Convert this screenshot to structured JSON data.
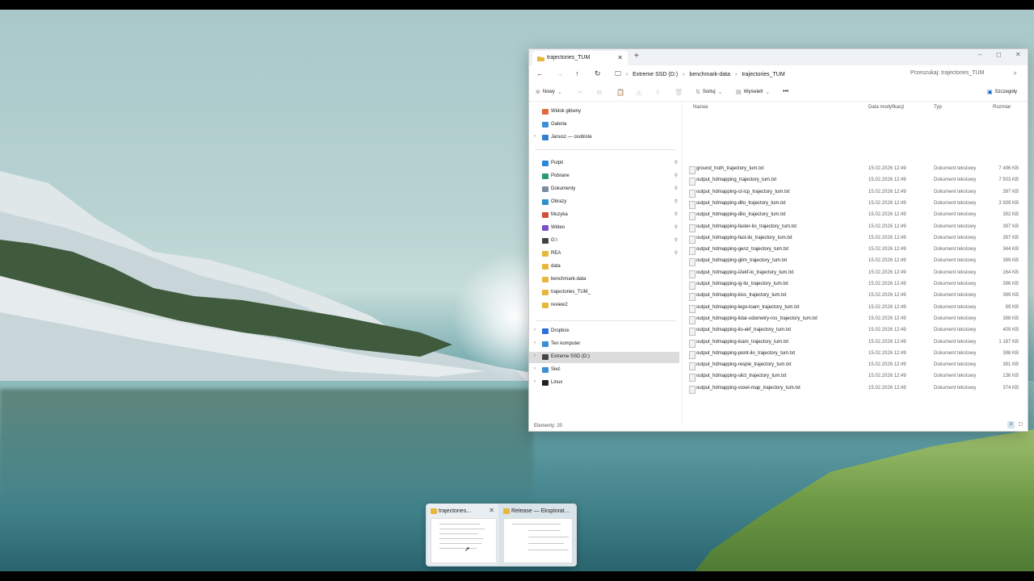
{
  "window": {
    "tab_title": "trajectories_TUM",
    "new_tab": "+",
    "controls": [
      "–",
      "◻",
      "✕"
    ]
  },
  "nav": {
    "breadcrumbs": [
      "Extreme SSD (D:)",
      "benchmark-data",
      "trajectories_TUM"
    ],
    "search_placeholder": "Przeszukaj: trajectories_TUM"
  },
  "toolbar": {
    "new_label": "Nowy",
    "sort_label": "Sortuj",
    "view_label": "Wyświetl",
    "more_label": "•••",
    "details_label": "Szczegóły"
  },
  "sidebar": {
    "items": [
      {
        "label": "Widok główny",
        "color": "#e06a3a",
        "chevron": false,
        "pin": false
      },
      {
        "label": "Galeria",
        "color": "#3a8fd6",
        "chevron": false,
        "pin": false
      },
      {
        "label": "Janusz — osobiste",
        "color": "#2f7fd0",
        "chevron": true,
        "pin": false
      },
      {
        "label": "Pulpit",
        "color": "#2b86d8",
        "chevron": false,
        "pin": true
      },
      {
        "label": "Pobrane",
        "color": "#2a9a6a",
        "chevron": false,
        "pin": true
      },
      {
        "label": "Dokumenty",
        "color": "#7d8d9e",
        "chevron": false,
        "pin": true
      },
      {
        "label": "Obrazy",
        "color": "#2f8fd0",
        "chevron": false,
        "pin": true
      },
      {
        "label": "Muzyka",
        "color": "#d0503a",
        "chevron": false,
        "pin": true
      },
      {
        "label": "Wideo",
        "color": "#7b4fc8",
        "chevron": false,
        "pin": true
      },
      {
        "label": "G:\\",
        "color": "#444444",
        "chevron": false,
        "pin": true
      },
      {
        "label": "REA",
        "color": "#e7b73b",
        "chevron": false,
        "pin": true
      },
      {
        "label": "data",
        "color": "#e7b73b",
        "chevron": false,
        "pin": false
      },
      {
        "label": "benchmark-data",
        "color": "#e7b73b",
        "chevron": false,
        "pin": false
      },
      {
        "label": "trajectories_TUM_",
        "color": "#e7b73b",
        "chevron": false,
        "pin": false
      },
      {
        "label": "review2",
        "color": "#e7b73b",
        "chevron": false,
        "pin": false
      },
      {
        "label": "Dropbox",
        "color": "#2a6fdb",
        "chevron": true,
        "pin": false
      },
      {
        "label": "Ten komputer",
        "color": "#3a8fd6",
        "chevron": true,
        "pin": false
      },
      {
        "label": "Extreme SSD (D:)",
        "color": "#444444",
        "chevron": true,
        "pin": false,
        "selected": true
      },
      {
        "label": "Sieć",
        "color": "#3a8fd6",
        "chevron": true,
        "pin": false
      },
      {
        "label": "Linux",
        "color": "#222222",
        "chevron": true,
        "pin": false
      }
    ]
  },
  "list": {
    "columns": {
      "name": "Nazwa",
      "date": "Data modyfikacji",
      "type": "Typ",
      "size": "Rozmiar"
    },
    "files": [
      {
        "name": "ground_truth_trajectory_tum.txt",
        "date": "15.02.2026 12:49",
        "type": "Dokument tekstowy",
        "size": "7 496 KB"
      },
      {
        "name": "output_hdmapping_trajectory_tum.txt",
        "date": "15.02.2026 12:49",
        "type": "Dokument tekstowy",
        "size": "7 503 KB"
      },
      {
        "name": "output_hdmapping-ct-icp_trajectory_tum.txt",
        "date": "15.02.2026 12:49",
        "type": "Dokument tekstowy",
        "size": "397 KB"
      },
      {
        "name": "output_hdmapping-dllo_trajectory_tum.txt",
        "date": "15.02.2026 12:49",
        "type": "Dokument tekstowy",
        "size": "3 939 KB"
      },
      {
        "name": "output_hdmapping-dlio_trajectory_tum.txt",
        "date": "15.02.2026 12:49",
        "type": "Dokument tekstowy",
        "size": "392 KB"
      },
      {
        "name": "output_hdmapping-faster-lio_trajectory_tum.txt",
        "date": "15.02.2026 12:49",
        "type": "Dokument tekstowy",
        "size": "397 KB"
      },
      {
        "name": "output_hdmapping-fast-lio_trajectory_tum.txt",
        "date": "15.02.2026 12:49",
        "type": "Dokument tekstowy",
        "size": "397 KB"
      },
      {
        "name": "output_hdmapping-genz_trajectory_tum.txt",
        "date": "15.02.2026 12:49",
        "type": "Dokument tekstowy",
        "size": "344 KB"
      },
      {
        "name": "output_hdmapping-glim_trajectory_tum.txt",
        "date": "15.02.2026 12:49",
        "type": "Dokument tekstowy",
        "size": "399 KB"
      },
      {
        "name": "output_hdmapping-i2ekf-lo_trajectory_tum.txt",
        "date": "15.02.2026 12:49",
        "type": "Dokument tekstowy",
        "size": "164 KB"
      },
      {
        "name": "output_hdmapping-ig-lio_trajectory_tum.txt",
        "date": "15.02.2026 12:49",
        "type": "Dokument tekstowy",
        "size": "396 KB"
      },
      {
        "name": "output_hdmapping-kiss_trajectory_tum.txt",
        "date": "15.02.2026 12:49",
        "type": "Dokument tekstowy",
        "size": "399 KB"
      },
      {
        "name": "output_hdmapping-lego-loam_trajectory_tum.txt",
        "date": "15.02.2026 12:49",
        "type": "Dokument tekstowy",
        "size": "99 KB"
      },
      {
        "name": "output_hdmapping-lidar-odometry-ros_trajectory_tum.txt",
        "date": "15.02.2026 12:49",
        "type": "Dokument tekstowy",
        "size": "398 KB"
      },
      {
        "name": "output_hdmapping-lio-ekf_trajectory_tum.txt",
        "date": "15.02.2026 12:49",
        "type": "Dokument tekstowy",
        "size": "409 KB"
      },
      {
        "name": "output_hdmapping-loam_trajectory_tum.txt",
        "date": "15.02.2026 12:49",
        "type": "Dokument tekstowy",
        "size": "1 187 KB"
      },
      {
        "name": "output_hdmapping-point-lio_trajectory_tum.txt",
        "date": "15.02.2026 12:49",
        "type": "Dokument tekstowy",
        "size": "398 KB"
      },
      {
        "name": "output_hdmapping-resple_trajectory_tum.txt",
        "date": "15.02.2026 12:49",
        "type": "Dokument tekstowy",
        "size": "391 KB"
      },
      {
        "name": "output_hdmapping-slict_trajectory_tum.txt",
        "date": "15.02.2026 12:49",
        "type": "Dokument tekstowy",
        "size": "136 KB"
      },
      {
        "name": "output_hdmapping-voxel-map_trajectory_tum.txt",
        "date": "15.02.2026 12:49",
        "type": "Dokument tekstowy",
        "size": "374 KB"
      }
    ],
    "status": "Elementy: 20"
  },
  "taskbar_preview": {
    "thumbs": [
      {
        "title": "trajectories...",
        "close": "✕"
      },
      {
        "title": "Release — Eksplorator plik..."
      }
    ]
  },
  "colors": {
    "folder": "#e7b73b",
    "accent": "#0067c0",
    "selection": "#dcdcdc"
  }
}
